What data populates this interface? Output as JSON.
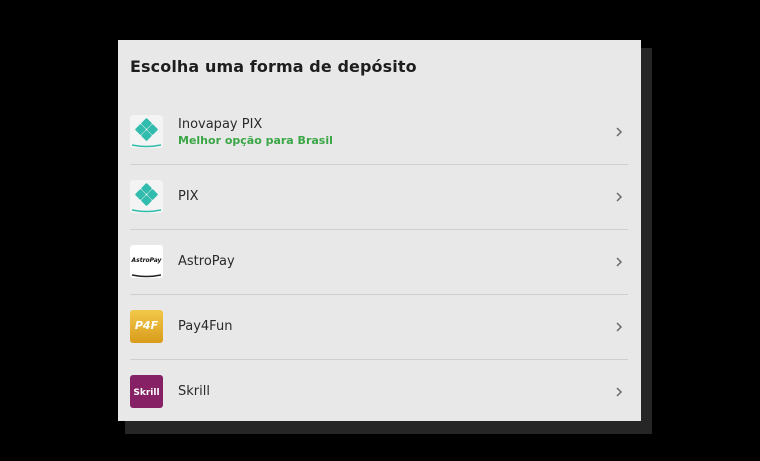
{
  "dialog": {
    "title": "Escolha uma forma de depósito"
  },
  "methods": [
    {
      "label": "Inovapay PIX",
      "sublabel": "Melhor opção para Brasil",
      "icon": "pix-icon"
    },
    {
      "label": "PIX",
      "icon": "pix-icon"
    },
    {
      "label": "AstroPay",
      "icon": "astropay-logo-icon",
      "logo_text": "AstroPay"
    },
    {
      "label": "Pay4Fun",
      "icon": "pay4fun-logo-icon",
      "logo_text": "P4F"
    },
    {
      "label": "Skrill",
      "icon": "skrill-logo-icon",
      "logo_text": "Skrill"
    }
  ],
  "colors": {
    "background": "#000000",
    "panel": "#e8e8e8",
    "accent_green": "#3aa645",
    "pix_teal": "#32bcad",
    "pay4fun_gold": "#e8b42a",
    "skrill_purple": "#862165"
  }
}
